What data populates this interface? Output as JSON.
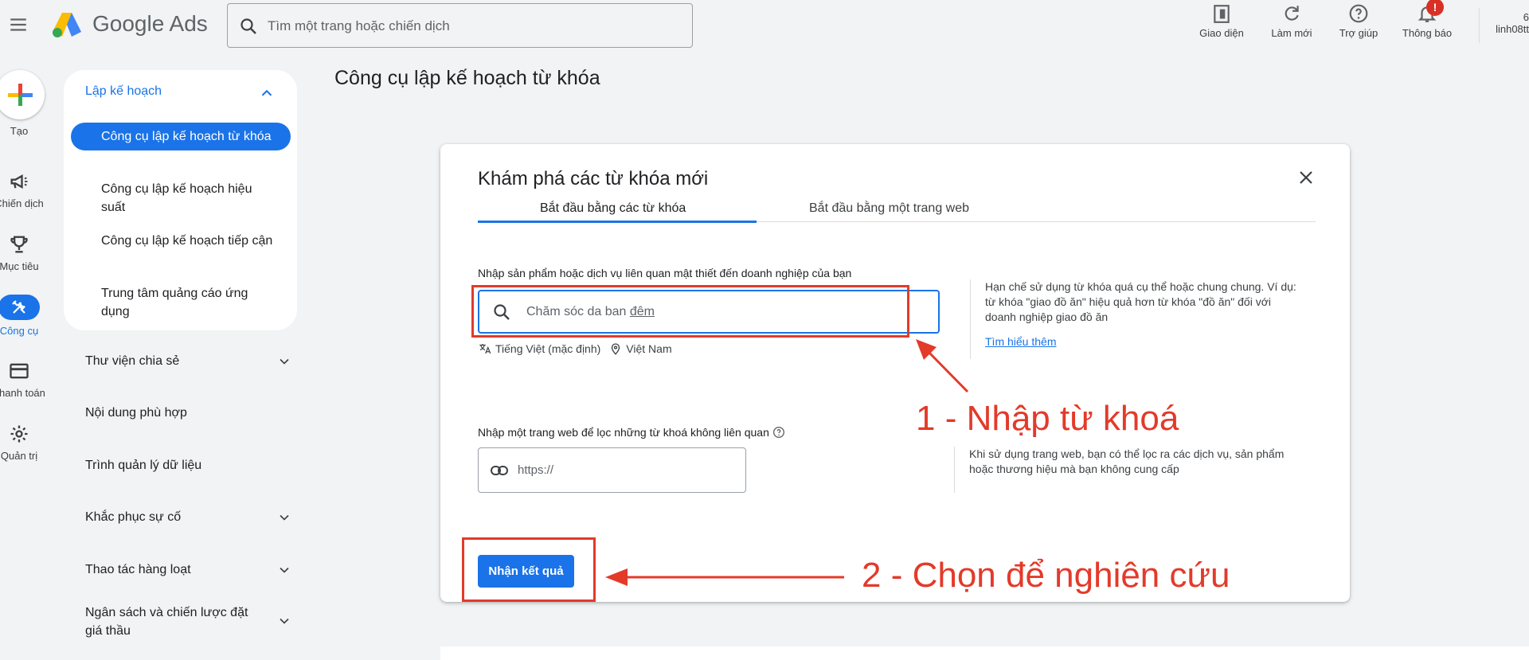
{
  "header": {
    "logo_text": "Google Ads",
    "search_placeholder": "Tìm một trang hoặc chiến dịch",
    "actions": [
      {
        "label": "Giao diện",
        "icon": "appearance-icon"
      },
      {
        "label": "Làm mới",
        "icon": "refresh-icon"
      },
      {
        "label": "Trợ giúp",
        "icon": "help-icon"
      },
      {
        "label": "Thông báo",
        "icon": "bell-icon",
        "badge": "!"
      }
    ],
    "account": {
      "line1": "6",
      "line2": "linh08tt"
    }
  },
  "rail": {
    "create": "Tạo",
    "items": [
      {
        "label": "Chiến dịch",
        "icon": "megaphone-icon"
      },
      {
        "label": "Mục tiêu",
        "icon": "trophy-icon"
      },
      {
        "label": "Công cụ",
        "icon": "tools-icon",
        "active": true
      },
      {
        "label": "Thanh toán",
        "icon": "card-icon"
      },
      {
        "label": "Quản trị",
        "icon": "gear-icon"
      }
    ]
  },
  "sidebar": {
    "planning_heading": "Lập kế hoạch",
    "planning_items": [
      "Công cụ lập kế hoạch từ khóa",
      "Công cụ lập kế hoạch hiệu suất",
      "Công cụ lập kế hoạch tiếp cận",
      "Trung tâm quảng cáo ứng dụng"
    ],
    "sections": [
      "Thư viện chia sẻ",
      "Nội dung phù hợp",
      "Trình quản lý dữ liệu",
      "Khắc phục sự cố",
      "Thao tác hàng loạt",
      "Ngân sách và chiến lược đặt giá thầu"
    ]
  },
  "page": {
    "title": "Công cụ lập kế hoạch từ khóa"
  },
  "dialog": {
    "title": "Khám phá các từ khóa mới",
    "tabs": [
      "Bắt đầu bằng các từ khóa",
      "Bắt đầu bằng một trang web"
    ],
    "keyword_label": "Nhập sản phẩm hoặc dịch vụ liên quan mật thiết đến doanh nghiệp của bạn",
    "keyword_placeholder_pre": "Chăm sóc da ban ",
    "keyword_placeholder_underlined": "đêm",
    "language": "Tiếng Việt (mặc định)",
    "location": "Việt Nam",
    "keyword_hint": "Hạn chế sử dụng từ khóa quá cụ thể hoặc chung chung. Ví dụ: từ khóa \"giao đồ ăn\" hiệu quả hơn từ khóa \"đồ ăn\" đối với doanh nghiệp giao đồ ăn",
    "learn_more": "Tìm hiểu thêm",
    "url_label": "Nhập một trang web để lọc những từ khoá không liên quan",
    "url_placeholder": "https://",
    "url_hint": "Khi sử dụng trang web, bạn có thể lọc ra các dịch vụ, sản phẩm hoặc thương hiệu mà bạn không cung cấp",
    "submit": "Nhận kết quả"
  },
  "annotations": {
    "step1": "1 - Nhập từ khoá",
    "step2": "2 - Chọn để nghiên cứu",
    "color": "#e33a2a"
  },
  "colors": {
    "accent": "#1a73e8",
    "background": "#f1f3f4"
  }
}
